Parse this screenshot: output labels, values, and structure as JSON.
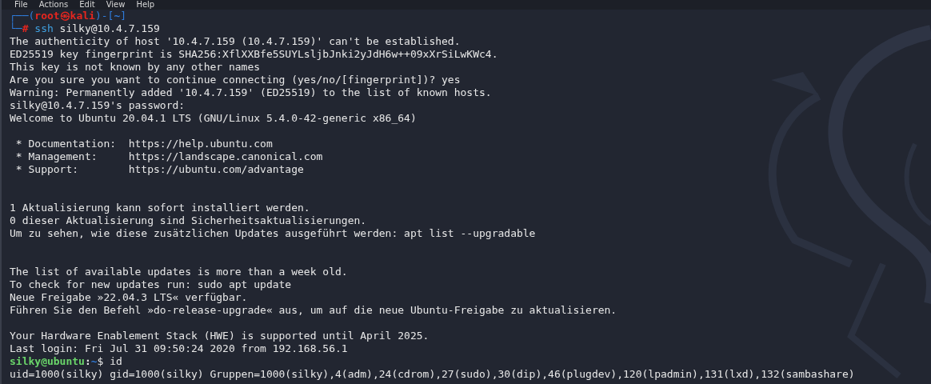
{
  "menu": [
    "File",
    "Actions",
    "Edit",
    "View",
    "Help"
  ],
  "lines": [
    {
      "kind": "kali_prompt",
      "open": "┌──(",
      "user": "root",
      "at": "㉿",
      "host": "kali",
      "mid": ")-[",
      "dir": "~",
      "close": "]"
    },
    {
      "kind": "root_command",
      "corner": "└─",
      "symbol": "#",
      "command": "ssh",
      "args": "silky@10.4.7.159"
    },
    {
      "kind": "output",
      "text": "The authenticity of host '10.4.7.159 (10.4.7.159)' can't be established."
    },
    {
      "kind": "output",
      "text": "ED25519 key fingerprint is SHA256:XflXXBfe5SUYLsljbJnki2yJdH6w++09xXrSiLwKWc4."
    },
    {
      "kind": "output",
      "text": "This key is not known by any other names"
    },
    {
      "kind": "output",
      "text": "Are you sure you want to continue connecting (yes/no/[fingerprint])? yes"
    },
    {
      "kind": "output",
      "text": "Warning: Permanently added '10.4.7.159' (ED25519) to the list of known hosts."
    },
    {
      "kind": "output",
      "text": "silky@10.4.7.159's password:"
    },
    {
      "kind": "output",
      "text": "Welcome to Ubuntu 20.04.1 LTS (GNU/Linux 5.4.0-42-generic x86_64)"
    },
    {
      "kind": "blank"
    },
    {
      "kind": "output",
      "text": " * Documentation:  https://help.ubuntu.com"
    },
    {
      "kind": "output",
      "text": " * Management:     https://landscape.canonical.com"
    },
    {
      "kind": "output",
      "text": " * Support:        https://ubuntu.com/advantage"
    },
    {
      "kind": "blank"
    },
    {
      "kind": "blank"
    },
    {
      "kind": "output",
      "text": "1 Aktualisierung kann sofort installiert werden."
    },
    {
      "kind": "output",
      "text": "0 dieser Aktualisierung sind Sicherheitsaktualisierungen."
    },
    {
      "kind": "output",
      "text": "Um zu sehen, wie diese zusätzlichen Updates ausgeführt werden: apt list --upgradable"
    },
    {
      "kind": "blank"
    },
    {
      "kind": "blank"
    },
    {
      "kind": "output",
      "text": "The list of available updates is more than a week old."
    },
    {
      "kind": "output",
      "text": "To check for new updates run: sudo apt update"
    },
    {
      "kind": "output",
      "text": "Neue Freigabe »22.04.3 LTS« verfügbar."
    },
    {
      "kind": "output",
      "text": "Führen Sie den Befehl »do-release-upgrade« aus, um auf die neue Ubuntu-Freigabe zu aktualisieren."
    },
    {
      "kind": "blank"
    },
    {
      "kind": "output",
      "text": "Your Hardware Enablement Stack (HWE) is supported until April 2025."
    },
    {
      "kind": "output",
      "text": "Last login: Fri Jul 31 09:50:24 2020 from 192.168.56.1"
    },
    {
      "kind": "user_prompt",
      "user_host": "silky@ubuntu",
      "colon": ":",
      "path": "~",
      "symbol": "$",
      "text": "id"
    },
    {
      "kind": "output",
      "text": "uid=1000(silky) gid=1000(silky) Gruppen=1000(silky),4(adm),24(cdrom),27(sudo),30(dip),46(plugdev),120(lpadmin),131(lxd),132(sambashare)"
    }
  ]
}
